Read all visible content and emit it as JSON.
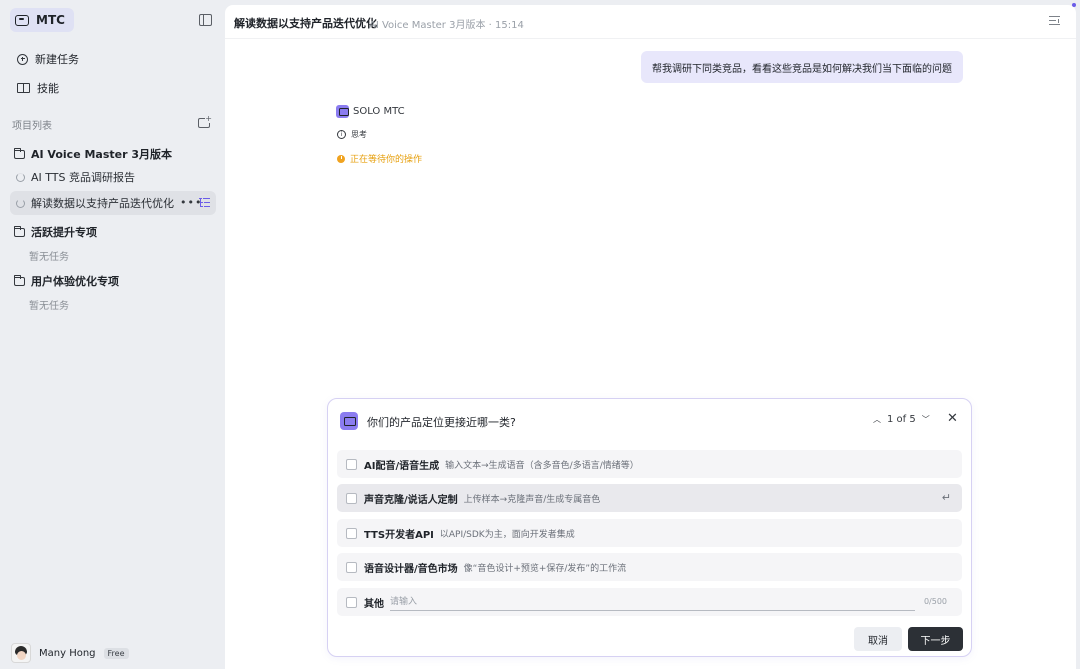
{
  "app": {
    "name": "MTC"
  },
  "nav": {
    "new_task": "新建任务",
    "skills": "技能",
    "projects_label": "项目列表"
  },
  "projects": [
    {
      "name": "AI Voice Master 3月版本",
      "tasks": [
        "AI TTS 竞品调研报告",
        "解读数据以支持产品迭代优化"
      ]
    },
    {
      "name": "活跃提升专项",
      "empty": "暂无任务"
    },
    {
      "name": "用户体验优化专项",
      "empty": "暂无任务"
    }
  ],
  "user": {
    "name": "Many Hong",
    "plan": "Free"
  },
  "header": {
    "title": "解读数据以支持产品迭代优化",
    "subtitle": "AI Voice Master 3月版本 · 15:14"
  },
  "chat": {
    "user_message": "帮我调研下同类竞品，看看这些竞品是如何解决我们当下面临的问题",
    "agent_name": "SOLO MTC",
    "thinking": "思考",
    "waiting": "正在等待你的操作"
  },
  "question": {
    "title": "你们的产品定位更接近哪一类?",
    "pager": "1 of 5",
    "options": [
      {
        "label": "AI配音/语音生成",
        "desc": "输入文本→生成语音（含多音色/多语言/情绪等）"
      },
      {
        "label": "声音克隆/说话人定制",
        "desc": "上传样本→克隆声音/生成专属音色"
      },
      {
        "label": "TTS开发者API",
        "desc": "以API/SDK为主，面向开发者集成"
      },
      {
        "label": "语音设计器/音色市场",
        "desc": "像“音色设计+预览+保存/发布”的工作流"
      }
    ],
    "other_label": "其他",
    "other_placeholder": "请输入",
    "other_counter": "0/500",
    "cancel": "取消",
    "next": "下一步"
  },
  "colors": {
    "accent": "#8b7cf0",
    "bubble": "#e8e7fb",
    "waiting": "#e7a111"
  }
}
